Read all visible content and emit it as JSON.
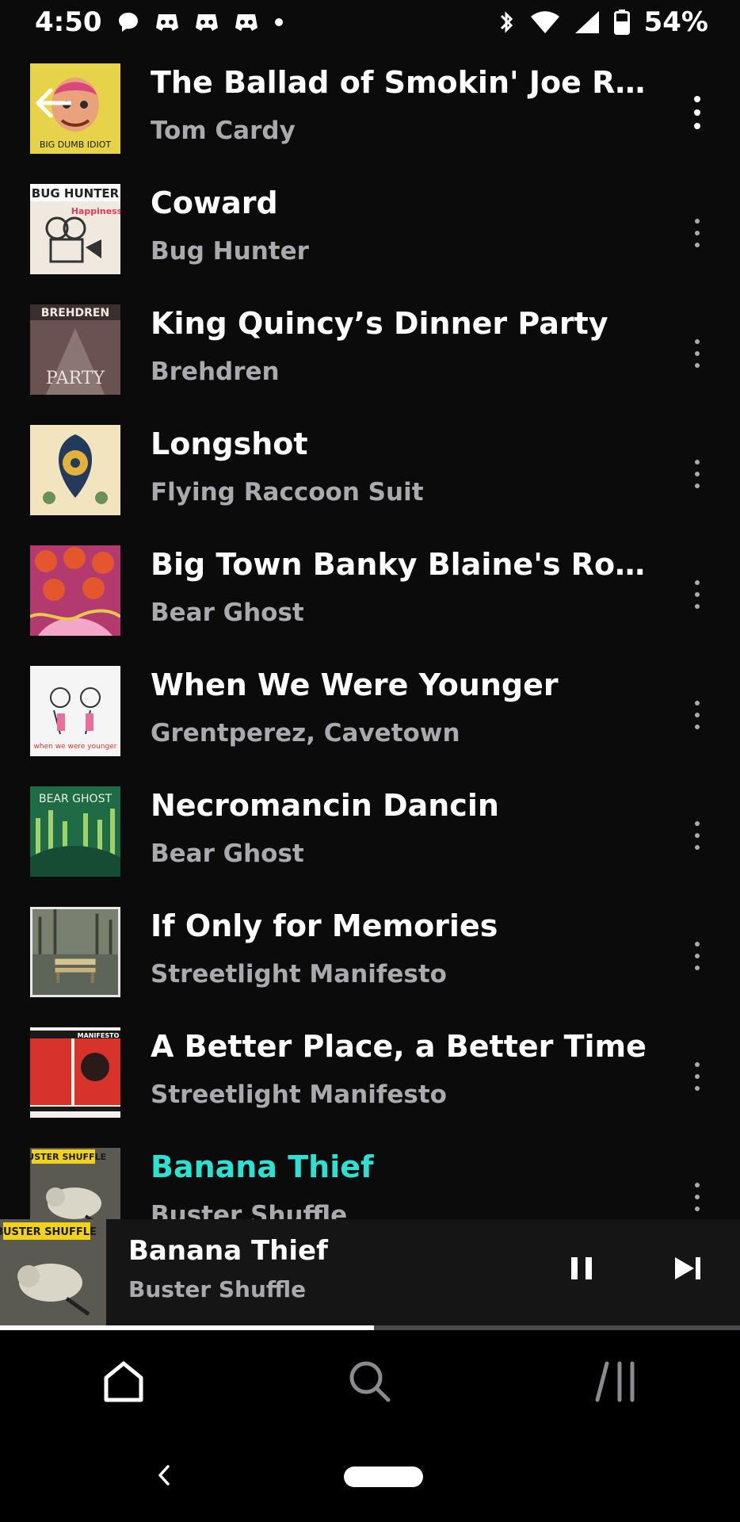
{
  "status_bar": {
    "time": "4:50",
    "battery": "54%"
  },
  "tracks": [
    {
      "title": "The Ballad of Smokin' Joe Rudeb...",
      "artist": "Tom Cardy",
      "cover_text": "BIG DUMB IDIOT",
      "cover_bg": "#e7d34a"
    },
    {
      "title": "Coward",
      "artist": "Bug Hunter",
      "cover_text": "BUG HUNTER",
      "cover_bg": "#efe9df"
    },
    {
      "title": "King Quincy’s Dinner Party",
      "artist": "Brehdren",
      "cover_text": "BREHDREN",
      "cover_bg": "#6a5250"
    },
    {
      "title": "Longshot",
      "artist": "Flying Raccoon Suit",
      "cover_text": "",
      "cover_bg": "#f3e4c0"
    },
    {
      "title": "Big Town Banky Blaine's Rockabi...",
      "artist": "Bear Ghost",
      "cover_text": "",
      "cover_bg": "#b23a6f"
    },
    {
      "title": "When We Were Younger",
      "artist": "Grentperez, Cavetown",
      "cover_text": "",
      "cover_bg": "#f5f5f5"
    },
    {
      "title": "Necromancin Dancin",
      "artist": "Bear Ghost",
      "cover_text": "BEAR GHOST",
      "cover_bg": "#1f6b45"
    },
    {
      "title": "If Only for Memories",
      "artist": "Streetlight Manifesto",
      "cover_text": "",
      "cover_bg": "#5d6458"
    },
    {
      "title": "A Better Place, a Better Time",
      "artist": "Streetlight Manifesto",
      "cover_text": "MANIFESTO",
      "cover_bg": "#d8332b"
    },
    {
      "title": "Banana Thief",
      "artist": "Buster Shuffle",
      "cover_text": "BUSTER SHUFFLE",
      "cover_bg": "#5a5a52"
    }
  ],
  "now_playing": {
    "title": "Banana Thief",
    "artist": "Buster Shuffle",
    "cover_text": "BUSTER SHUFFLE",
    "progress": 0.505
  },
  "nav": {
    "items": [
      "home-icon",
      "search-icon",
      "library-icon"
    ]
  },
  "colors": {
    "accent": "#2de0d2",
    "background": "#0b0b0c",
    "secondary_text": "#a9a9ae"
  }
}
